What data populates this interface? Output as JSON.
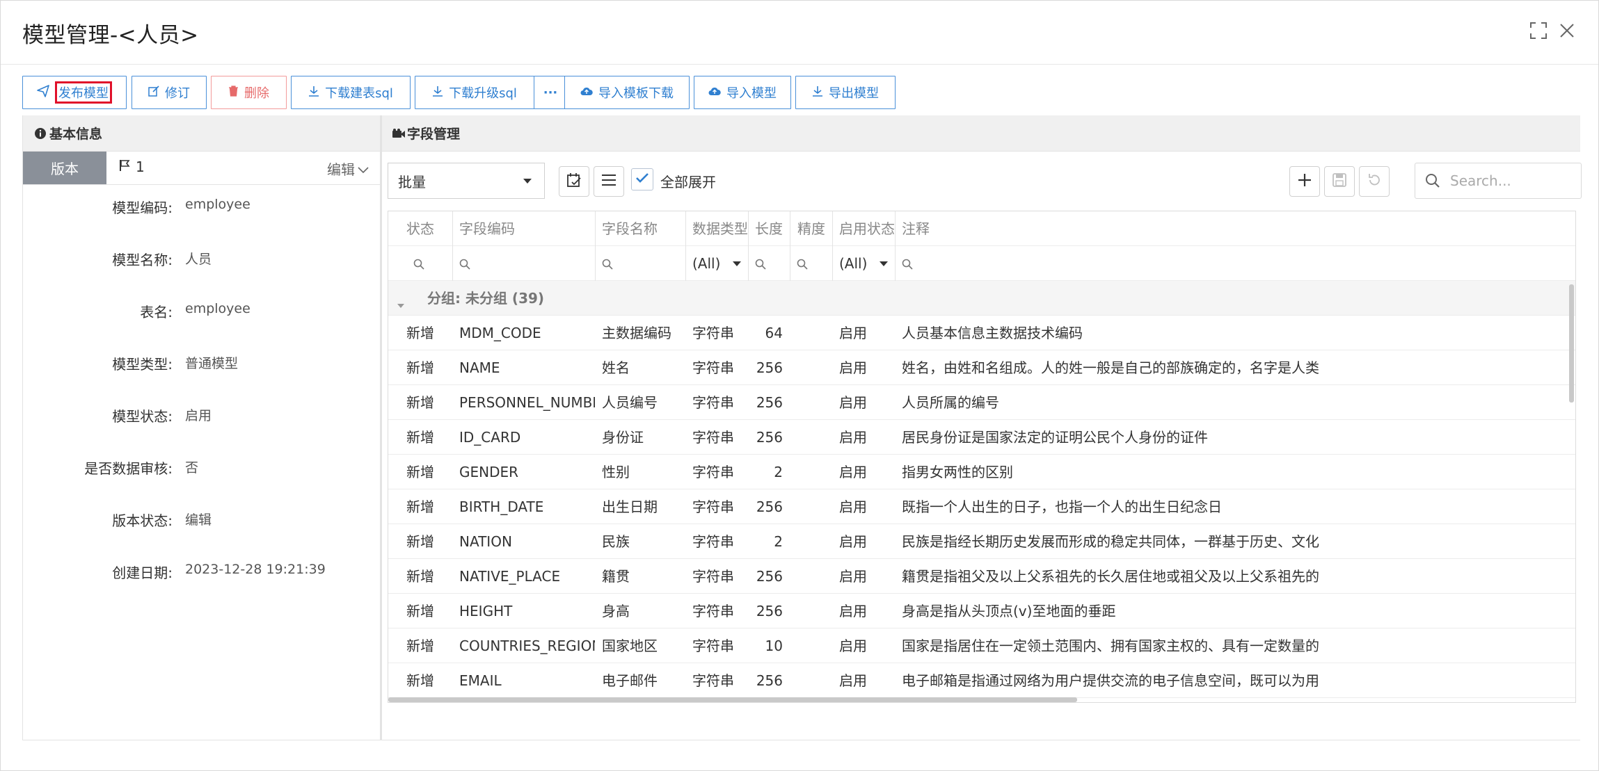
{
  "dialog": {
    "title": "模型管理-<人员>",
    "maximize_icon": "maximize-icon",
    "close_icon": "close-icon"
  },
  "toolbar": {
    "publish": "发布模型",
    "revise": "修订",
    "delete": "删除",
    "download_create_sql": "下载建表sql",
    "download_upgrade_sql": "下载升级sql",
    "more": "···",
    "import_template_download": "导入模板下载",
    "import_model": "导入模型",
    "export_model": "导出模型"
  },
  "basic_info": {
    "title": "基本信息",
    "version_tab": "版本",
    "version_number": "1",
    "edit_label": "编辑",
    "fields": [
      {
        "label": "模型编码:",
        "value": "employee"
      },
      {
        "label": "模型名称:",
        "value": "人员"
      },
      {
        "label": "表名:",
        "value": "employee"
      },
      {
        "label": "模型类型:",
        "value": "普通模型"
      },
      {
        "label": "模型状态:",
        "value": "启用"
      },
      {
        "label": "是否数据审核:",
        "value": "否"
      },
      {
        "label": "版本状态:",
        "value": "编辑"
      },
      {
        "label": "创建日期:",
        "value": "2023-12-28 19:21:39"
      }
    ]
  },
  "field_management": {
    "title": "字段管理",
    "batch_select": "批量",
    "expand_all": "全部展开",
    "search_placeholder": "Search...",
    "columns": [
      "状态",
      "字段编码",
      "字段名称",
      "数据类型",
      "长度",
      "精度",
      "启用状态",
      "注释"
    ],
    "filter_all": "(All)",
    "group_label": "分组: 未分组 (39)",
    "rows": [
      {
        "status": "新增",
        "code": "MDM_CODE",
        "name": "主数据编码",
        "type": "字符串",
        "length": "64",
        "precision": "",
        "enabled": "启用",
        "comment": "人员基本信息主数据技术编码"
      },
      {
        "status": "新增",
        "code": "NAME",
        "name": "姓名",
        "type": "字符串",
        "length": "256",
        "precision": "",
        "enabled": "启用",
        "comment": "姓名，由姓和名组成。人的姓一般是自己的部族确定的，名字是人类"
      },
      {
        "status": "新增",
        "code": "PERSONNEL_NUMBER",
        "name": "人员编号",
        "type": "字符串",
        "length": "256",
        "precision": "",
        "enabled": "启用",
        "comment": "人员所属的编号"
      },
      {
        "status": "新增",
        "code": "ID_CARD",
        "name": "身份证",
        "type": "字符串",
        "length": "256",
        "precision": "",
        "enabled": "启用",
        "comment": "居民身份证是国家法定的证明公民个人身份的证件"
      },
      {
        "status": "新增",
        "code": "GENDER",
        "name": "性别",
        "type": "字符串",
        "length": "2",
        "precision": "",
        "enabled": "启用",
        "comment": "指男女两性的区别"
      },
      {
        "status": "新增",
        "code": "BIRTH_DATE",
        "name": "出生日期",
        "type": "字符串",
        "length": "256",
        "precision": "",
        "enabled": "启用",
        "comment": "既指一个人出生的日子，也指一个人的出生日纪念日"
      },
      {
        "status": "新增",
        "code": "NATION",
        "name": "民族",
        "type": "字符串",
        "length": "2",
        "precision": "",
        "enabled": "启用",
        "comment": "民族是指经长期历史发展而形成的稳定共同体，一群基于历史、文化"
      },
      {
        "status": "新增",
        "code": "NATIVE_PLACE",
        "name": "籍贯",
        "type": "字符串",
        "length": "256",
        "precision": "",
        "enabled": "启用",
        "comment": "籍贯是指祖父及以上父系祖先的长久居住地或祖父及以上父系祖先的"
      },
      {
        "status": "新增",
        "code": "HEIGHT",
        "name": "身高",
        "type": "字符串",
        "length": "256",
        "precision": "",
        "enabled": "启用",
        "comment": "身高是指从头顶点(v)至地面的垂距"
      },
      {
        "status": "新增",
        "code": "COUNTRIES_REGIONS",
        "name": "国家地区",
        "type": "字符串",
        "length": "10",
        "precision": "",
        "enabled": "启用",
        "comment": "国家是指居住在一定领土范围内、拥有国家主权的、具有一定数量的"
      },
      {
        "status": "新增",
        "code": "EMAIL",
        "name": "电子邮件",
        "type": "字符串",
        "length": "256",
        "precision": "",
        "enabled": "启用",
        "comment": "电子邮箱是指通过网络为用户提供交流的电子信息空间，既可以为用"
      }
    ]
  }
}
